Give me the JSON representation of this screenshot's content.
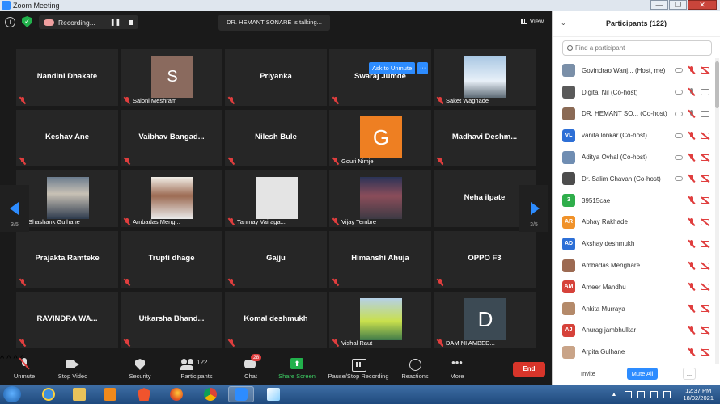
{
  "window": {
    "title": "Zoom Meeting",
    "minimize": "—",
    "maximize": "❐",
    "close": "✕"
  },
  "topbar": {
    "info": "i",
    "shield": "✓",
    "recording_label": "Recording...",
    "pause": "❚❚",
    "talking": "DR. HEMANT SONARE is talking...",
    "view_label": "View"
  },
  "tiles": [
    {
      "name": "Nandini Dhakate",
      "label": "",
      "kind": "name"
    },
    {
      "name": "",
      "label": "Saloni Meshram",
      "kind": "avatar",
      "letter": "S",
      "style": "av-s"
    },
    {
      "name": "Priyanka",
      "label": "",
      "kind": "name"
    },
    {
      "name": "Swaraj Jumde",
      "label": "",
      "kind": "name"
    },
    {
      "name": "",
      "label": "Saket Waghade",
      "kind": "photo",
      "style": "photo-sky"
    },
    {
      "name": "Keshav Ane",
      "label": "",
      "kind": "name"
    },
    {
      "name": "Vaibhav  Bangad...",
      "label": "",
      "kind": "name"
    },
    {
      "name": "Nilesh Bule",
      "label": "",
      "kind": "name"
    },
    {
      "name": "",
      "label": "Gouri Nimje",
      "kind": "avatar",
      "letter": "G",
      "style": "av-g"
    },
    {
      "name": "Madhavi  Deshm...",
      "label": "",
      "kind": "name"
    },
    {
      "name": "",
      "label": "Shashank Gulhane",
      "kind": "photo",
      "style": "photo-man"
    },
    {
      "name": "",
      "label": "Ambadas Meng...",
      "kind": "photo",
      "style": "photo-man2"
    },
    {
      "name": "",
      "label": "Tanmay Vairaga...",
      "kind": "photo",
      "style": "photo-blank"
    },
    {
      "name": "",
      "label": "Vijay Tembre",
      "kind": "photo",
      "style": "photo-group"
    },
    {
      "name": "Neha ilpate",
      "label": "",
      "kind": "name",
      "nomic": true
    },
    {
      "name": "Prajakta Ramteke",
      "label": "",
      "kind": "name"
    },
    {
      "name": "Trupti dhage",
      "label": "",
      "kind": "name"
    },
    {
      "name": "Gajju",
      "label": "",
      "kind": "name"
    },
    {
      "name": "Himanshi Ahuja",
      "label": "",
      "kind": "name"
    },
    {
      "name": "OPPO F3",
      "label": "",
      "kind": "name"
    },
    {
      "name": "RAVINDRA WA...",
      "label": "",
      "kind": "name"
    },
    {
      "name": "Utkarsha  Bhand...",
      "label": "",
      "kind": "name"
    },
    {
      "name": "Komal deshmukh",
      "label": "",
      "kind": "name"
    },
    {
      "name": "",
      "label": "Vishal Raut",
      "kind": "photo",
      "style": "photo-boy"
    },
    {
      "name": "",
      "label": "DAMINI AMBED...",
      "kind": "avatar",
      "letter": "D",
      "style": "av-d"
    }
  ],
  "popover": {
    "ask_to_unmute": "Ask to Unmute",
    "more": "···"
  },
  "pager": {
    "left": "3/5",
    "right": "3/5"
  },
  "toolbar": {
    "unmute": "Unmute",
    "stop_video": "Stop Video",
    "security": "Security",
    "participants": "Participants",
    "participants_count": "122",
    "chat": "Chat",
    "chat_badge": "28",
    "share_screen": "Share Screen",
    "pause_recording": "Pause/Stop Recording",
    "reactions": "Reactions",
    "more": "More",
    "more_dots": "•••",
    "end": "End",
    "caret": "^"
  },
  "panel": {
    "title": "Participants (122)",
    "chevron": "⌄",
    "search_placeholder": "Find a participant",
    "participants": [
      {
        "name": "Govindrao Wanj...  (Host, me)",
        "initials": "",
        "color": "#7a8fa8",
        "mic": "off",
        "video": "off"
      },
      {
        "name": "Digital Nil (Co-host)",
        "initials": "",
        "color": "#5a5a5a",
        "mic": "on",
        "video": "on"
      },
      {
        "name": "DR. HEMANT SO...  (Co-host)",
        "initials": "",
        "color": "#8a6a55",
        "mic": "on",
        "video": "on"
      },
      {
        "name": "vanita lonkar (Co-host)",
        "initials": "VL",
        "color": "#2d6fd6",
        "mic": "off",
        "video": "off"
      },
      {
        "name": "Aditya Ovhal (Co-host)",
        "initials": "",
        "color": "#6f8db2",
        "mic": "off",
        "video": "off"
      },
      {
        "name": "Dr. Salim Chavan (Co-host)",
        "initials": "",
        "color": "#4d4d4d",
        "mic": "off",
        "video": "off"
      },
      {
        "name": "39515cae",
        "initials": "3",
        "color": "#2fae4b",
        "mic": "off",
        "video": "off"
      },
      {
        "name": "Abhay Rakhade",
        "initials": "AR",
        "color": "#f0922a",
        "mic": "off",
        "video": "off"
      },
      {
        "name": "Akshay deshmukh",
        "initials": "AD",
        "color": "#2d6fd6",
        "mic": "off",
        "video": "off"
      },
      {
        "name": "Ambadas Menghare",
        "initials": "",
        "color": "#9c6a52",
        "mic": "off",
        "video": "off"
      },
      {
        "name": "Ameer Mandhu",
        "initials": "AM",
        "color": "#d6423a",
        "mic": "off",
        "video": "off"
      },
      {
        "name": "Ankita Murraya",
        "initials": "",
        "color": "#b48a6a",
        "mic": "off",
        "video": "off"
      },
      {
        "name": "Anurag jambhulkar",
        "initials": "AJ",
        "color": "#d6423a",
        "mic": "off",
        "video": "off"
      },
      {
        "name": "Arpita Gulhane",
        "initials": "",
        "color": "#c9a488",
        "mic": "off",
        "video": "off"
      }
    ],
    "invite": "Invite",
    "mute_all": "Mute All",
    "more": "..."
  },
  "taskbar": {
    "clock_time": "12:37 PM",
    "clock_date": "18/02/2021",
    "tray_arrow": "▲"
  }
}
